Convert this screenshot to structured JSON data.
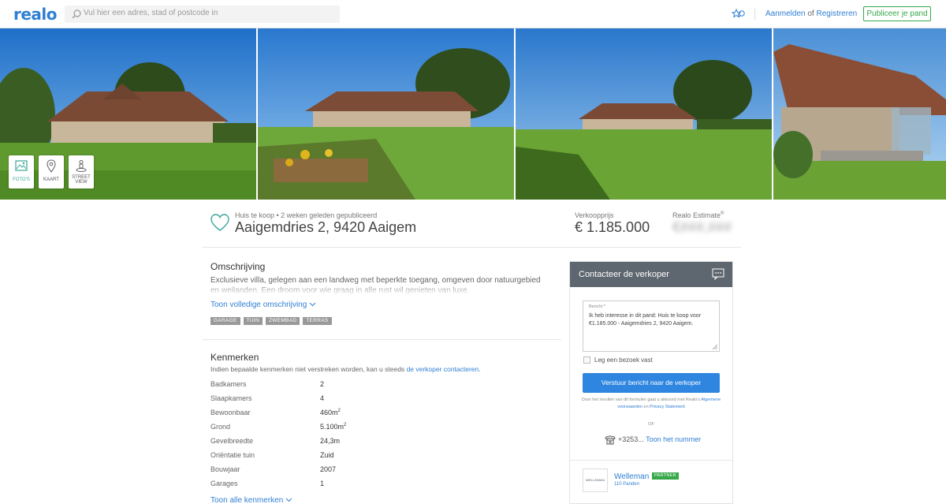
{
  "header": {
    "logo": "realo",
    "search_placeholder": "Vul hier een adres, stad of postcode in",
    "login": "Aanmelden",
    "login_of": "of",
    "register": "Registreren",
    "publish": "Publiceer je pand"
  },
  "gallery": {
    "buttons": [
      {
        "label": "FOTO'S",
        "icon": "image-icon"
      },
      {
        "label": "KAART",
        "icon": "map-pin-icon"
      },
      {
        "label_line1": "STREET",
        "label_line2": "VIEW",
        "icon": "street-view-icon"
      }
    ]
  },
  "listing": {
    "subtitle": "Huis te koop • 2 weken geleden gepubliceerd",
    "address": "Aaigemdries 2, 9420 Aaigem",
    "price_label": "Verkoopprijs",
    "price": "€ 1.185.000",
    "estimate_label": "Realo Estimate",
    "estimate_mark": "®",
    "estimate_value": "€###,###"
  },
  "description": {
    "heading": "Omschrijving",
    "text": "Exclusieve villa, gelegen aan een landweg met beperkte toegang, omgeven door natuurgebied en weilanden. Een droom voor wie graag in alle rust wil genieten van luxe.",
    "more": "Toon volledige omschrijving",
    "tags": [
      "GARAGE",
      "TUIN",
      "ZWEMBAD",
      "TERRAS"
    ]
  },
  "features": {
    "heading": "Kenmerken",
    "note": "Indien bepaalde kenmerken niet verstreken worden, kan u steeds",
    "note_link": "de verkoper contacteren",
    "note_end": ".",
    "rows": [
      {
        "key": "Badkamers",
        "value": "2",
        "sup": ""
      },
      {
        "key": "Slaapkamers",
        "value": "4",
        "sup": ""
      },
      {
        "key": "Bewoonbaar",
        "value": "460m",
        "sup": "2"
      },
      {
        "key": "Grond",
        "value": "5.100m",
        "sup": "2"
      },
      {
        "key": "Gevelbreedte",
        "value": "24,3m",
        "sup": ""
      },
      {
        "key": "Oriëntatie tuin",
        "value": "Zuid",
        "sup": ""
      },
      {
        "key": "Bouwjaar",
        "value": "2007",
        "sup": ""
      },
      {
        "key": "Garages",
        "value": "1",
        "sup": ""
      }
    ],
    "more": "Toon alle kenmerken"
  },
  "contact": {
    "title": "Contacteer de verkoper",
    "message_label": "Bericht *",
    "message": "Ik heb interesse in dit pand: Huis te koop voor €1.185.000 - Aaigemdries 2, 9420 Aaigem.",
    "visit_label": "Leg een bezoek vast",
    "send": "Verstuur bericht naar de verkoper",
    "terms_pre": "Door het invullen van dit formulier gaat u akkoord met Realo's",
    "terms_link1": "Algemene voorwaarden",
    "terms_en": "en",
    "terms_link2": "Privacy Statement",
    "or": "OF",
    "phone_prefix": "+3253...",
    "phone_show": "Toon het nummer",
    "agency_logo": "WELLEMAN",
    "agency_name": "Welleman",
    "partner": "PARTNER",
    "agency_count": "110 Panden"
  },
  "colors": {
    "brand_blue": "#2f7fd2",
    "accent_green": "#37a84a",
    "teal": "#3aa89a",
    "contact_header": "#5e666f"
  }
}
